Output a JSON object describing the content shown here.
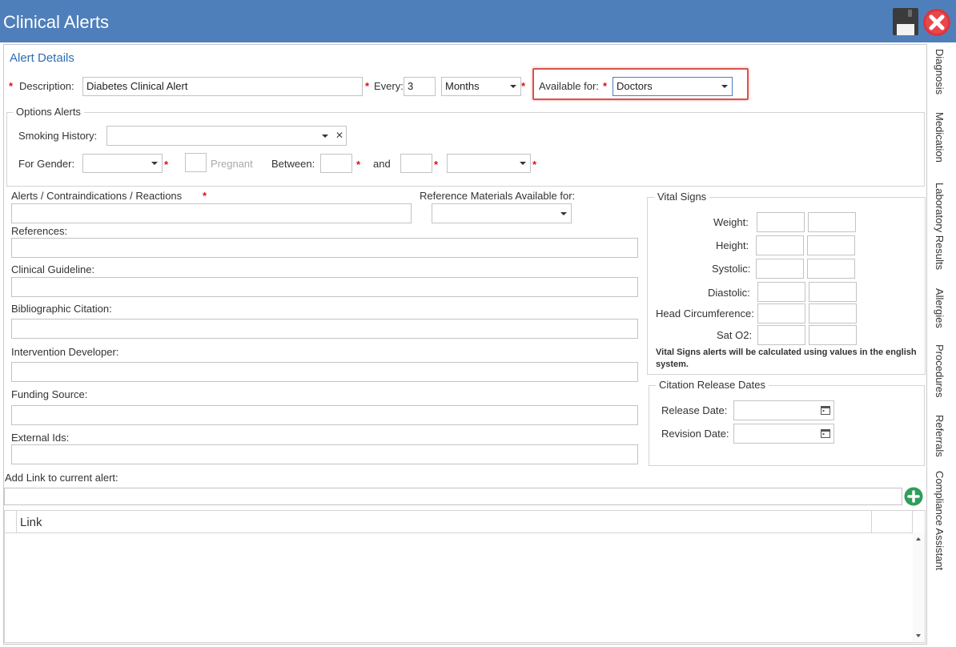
{
  "window": {
    "title": "Clinical Alerts"
  },
  "section_title": "Alert Details",
  "required_mark": "*",
  "description": {
    "label": "Description:",
    "value": "Diabetes Clinical Alert"
  },
  "every": {
    "label": "Every:",
    "value": "3",
    "unit": "Months"
  },
  "available_for": {
    "label": "Available for:",
    "value": "Doctors"
  },
  "options_alerts": {
    "legend": "Options Alerts",
    "smoking_history_label": "Smoking History:",
    "clear_glyph": "✕",
    "for_gender_label": "For Gender:",
    "pregnant_label": "Pregnant",
    "between_label": "Between:",
    "and_label": "and"
  },
  "fields": {
    "alerts_label": "Alerts / Contraindications / Reactions",
    "reference_materials_label": "Reference Materials Available for:",
    "references_label": "References:",
    "clinical_guideline_label": "Clinical Guideline:",
    "bibliographic_citation_label": "Bibliographic Citation:",
    "intervention_developer_label": "Intervention Developer:",
    "funding_source_label": "Funding Source:",
    "external_ids_label": "External Ids:"
  },
  "vital_signs": {
    "legend": "Vital Signs",
    "weight": "Weight:",
    "height": "Height:",
    "systolic": "Systolic:",
    "diastolic": "Diastolic:",
    "head_circumference": "Head Circumference:",
    "sat_o2": "Sat O2:",
    "note": "Vital Signs alerts will be calculated using values in the english system."
  },
  "citation_dates": {
    "legend": "Citation Release Dates",
    "release_date": "Release Date:",
    "revision_date": "Revision Date:"
  },
  "links": {
    "add_label": "Add Link to current alert:",
    "column_link": "Link"
  },
  "side_tabs": [
    "Diagnosis",
    "Medication",
    "Laboratory Results",
    "Allergies",
    "Procedures",
    "Referrals",
    "Compliance Assistant"
  ],
  "colors": {
    "titlebar": "#4f7fbb",
    "section_title": "#2e6db4",
    "required": "#dd1111",
    "highlight_border": "#d9534f",
    "add_button": "#2e9e5b",
    "close_button": "#d9363e"
  },
  "icons": {
    "save": "floppy-disk-icon",
    "close": "close-circle-icon",
    "add": "plus-circle-icon",
    "calendar": "calendar-icon"
  }
}
